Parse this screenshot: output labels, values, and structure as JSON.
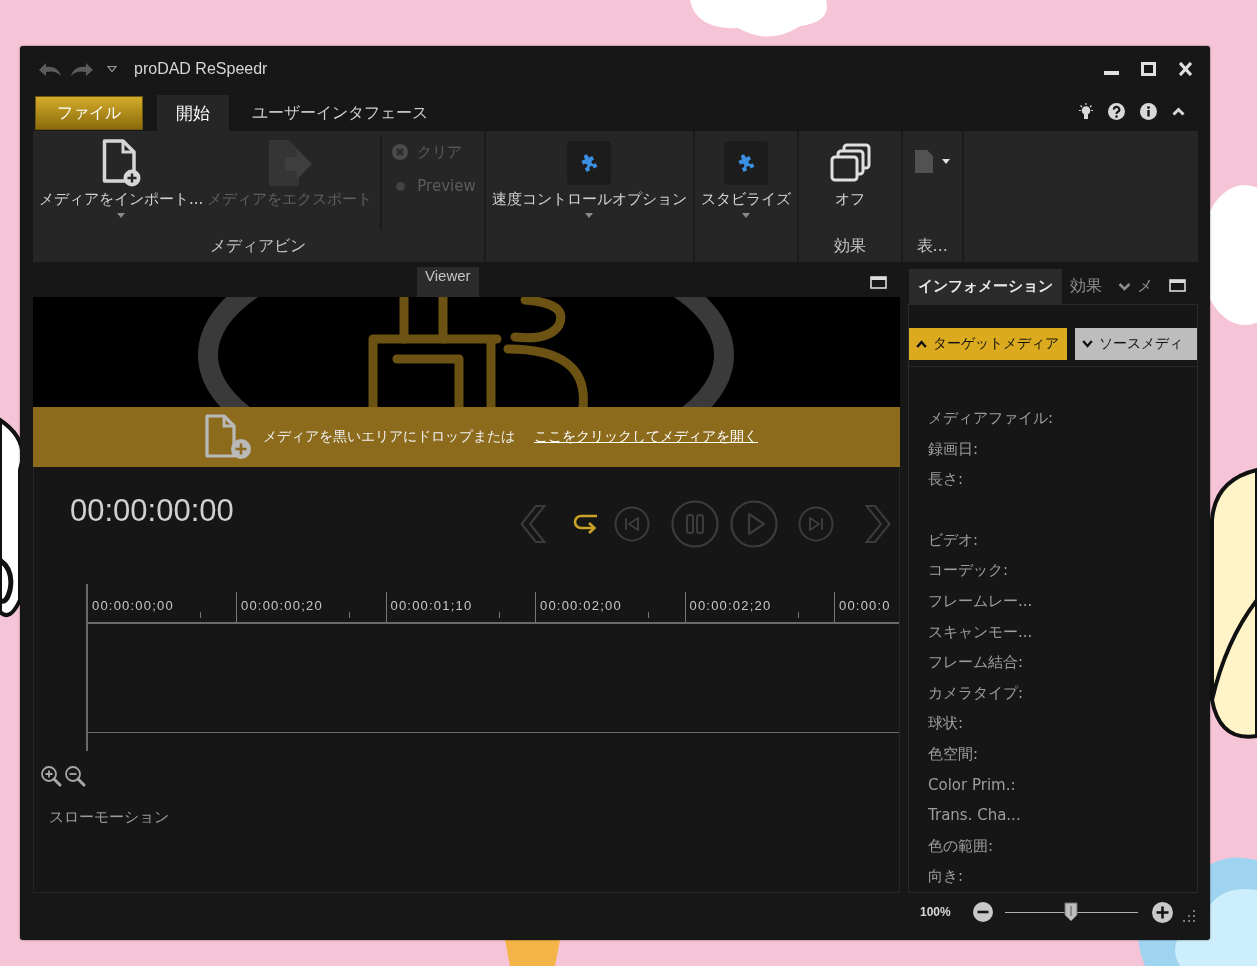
{
  "window": {
    "title": "proDAD ReSpeedr"
  },
  "ribbon": {
    "file_button": "ファイル",
    "tabs": [
      {
        "label": "開始",
        "selected": true
      },
      {
        "label": "ユーザーインタフェース",
        "selected": false
      }
    ],
    "groups": [
      {
        "label": "メディアビン",
        "buttons": [
          {
            "kind": "large",
            "label": "メディアをインポート...",
            "disabled": false,
            "dropdown": true
          },
          {
            "kind": "large",
            "label": "メディアをエクスポート",
            "disabled": true,
            "dropdown": false
          },
          {
            "kind": "small",
            "label": "クリア",
            "disabled": true,
            "dropdown": false
          },
          {
            "kind": "small",
            "label": "Preview",
            "disabled": true,
            "dropdown": false
          }
        ]
      },
      {
        "buttons": [
          {
            "kind": "tile",
            "label": "速度コントロールオプション",
            "disabled": false,
            "dropdown": true
          }
        ]
      },
      {
        "buttons": [
          {
            "kind": "tile",
            "label": "スタビライズ",
            "disabled": false,
            "dropdown": true
          }
        ]
      },
      {
        "label": "効果",
        "buttons": [
          {
            "kind": "large",
            "label": "オフ",
            "disabled": false,
            "dropdown": false
          }
        ]
      },
      {
        "label": "表...",
        "buttons": [
          {
            "kind": "icon",
            "disabled": false,
            "dropdown": true
          }
        ]
      }
    ]
  },
  "viewer": {
    "title": "Viewer",
    "drop_hint": "メディアを黒いエリアにドロップまたは",
    "open_link": "ここをクリックしてメディアを開く",
    "timecode": "00:00:00:00",
    "transport": [
      {
        "kind": "previous",
        "on": false
      },
      {
        "kind": "loop",
        "on": true
      },
      {
        "kind": "start",
        "on": false
      },
      {
        "kind": "pause",
        "on": false
      },
      {
        "kind": "play",
        "on": false
      },
      {
        "kind": "end",
        "on": false
      },
      {
        "kind": "next",
        "on": false
      }
    ],
    "ruler": [
      "00:00:00;00",
      "00:00:00;20",
      "00:00:01;10",
      "00:00:02;00",
      "00:00:02;20",
      "00:00:0"
    ],
    "track_label": "スローモーション"
  },
  "info_panel": {
    "tabs": [
      {
        "label": "インフォメーション",
        "selected": true,
        "dropdown": false
      },
      {
        "label": "効果",
        "selected": false,
        "dropdown": false
      },
      {
        "label": "メ",
        "selected": false,
        "dropdown": true
      }
    ],
    "sections": [
      {
        "label": "ターゲットメディア",
        "expanded": true
      },
      {
        "label": "ソースメディ",
        "expanded": false
      }
    ],
    "field_groups": [
      [
        "メディアファイル:",
        "録画日:",
        "長さ:"
      ],
      [
        "ビデオ:",
        "コーデック:",
        "フレームレー...",
        "スキャンモー...",
        "フレーム結合:",
        "カメラタイプ:",
        "球状:",
        "色空間:",
        "Color Prim.:",
        "Trans. Cha...",
        "色の範囲:",
        "向き:"
      ]
    ]
  },
  "status_bar": {
    "zoom": "100%",
    "level": 0.5
  }
}
